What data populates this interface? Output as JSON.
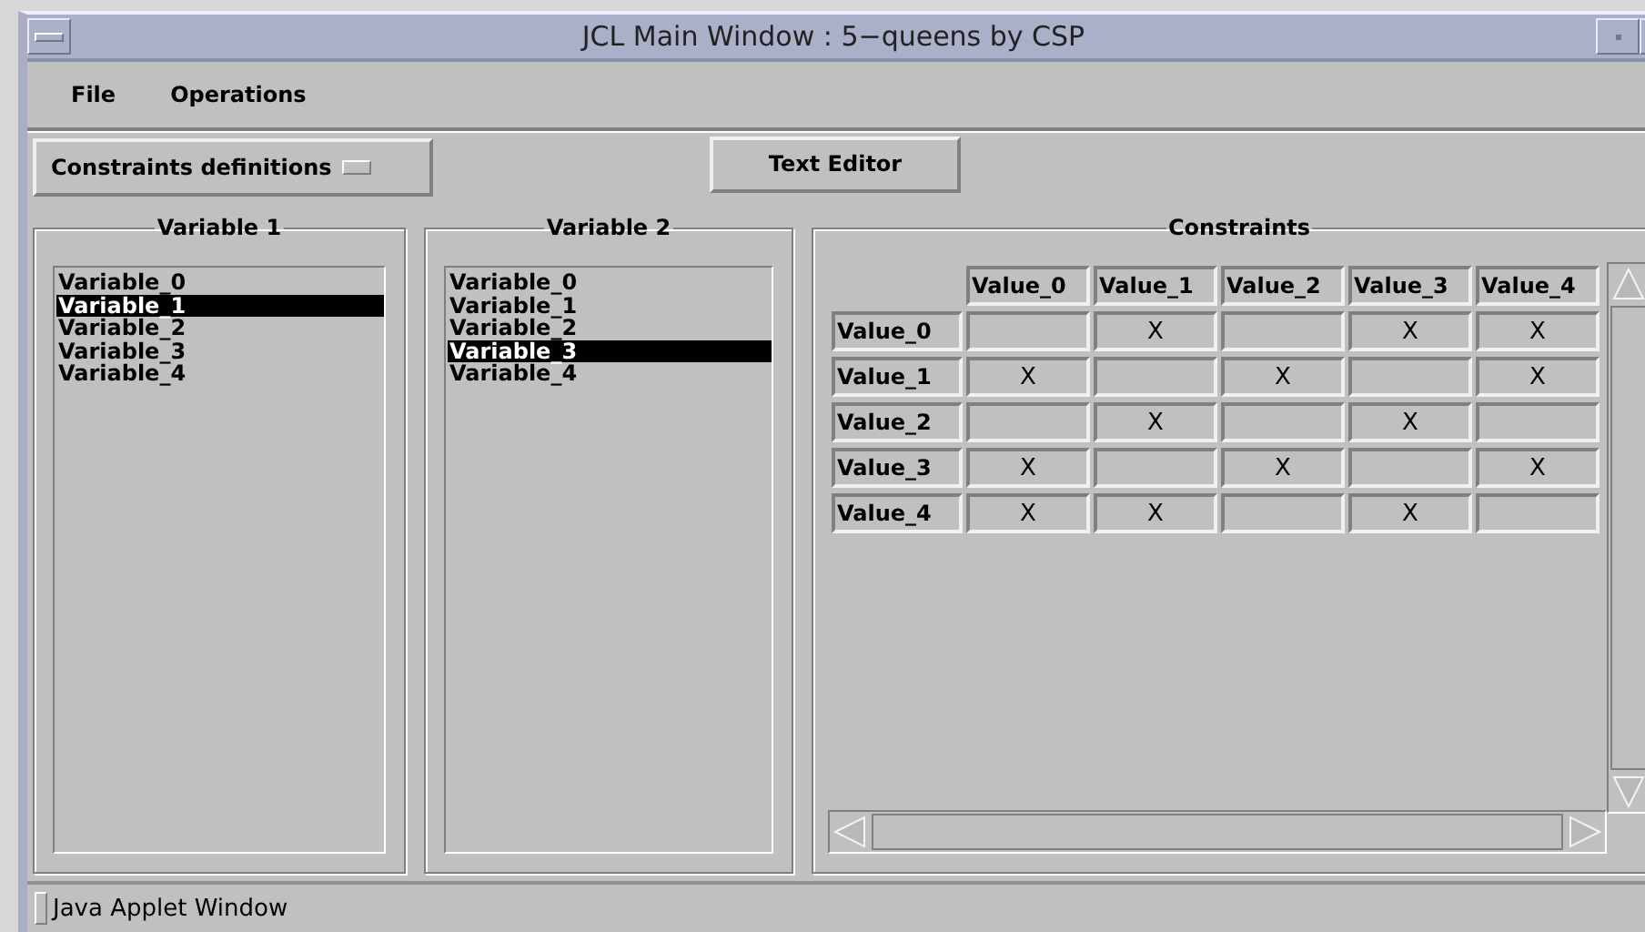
{
  "window": {
    "title": "JCL Main Window : 5−queens by CSP"
  },
  "menu": [
    "File",
    "Operations"
  ],
  "toolbar": {
    "choice": "Constraints definitions",
    "button": "Text Editor"
  },
  "variable_lists": [
    {
      "title": "Variable 1",
      "items": [
        {
          "label": "Variable_0",
          "selected": false
        },
        {
          "label": "Variable_1",
          "selected": true
        },
        {
          "label": "Variable_2",
          "selected": false
        },
        {
          "label": "Variable_3",
          "selected": false
        },
        {
          "label": "Variable_4",
          "selected": false
        }
      ]
    },
    {
      "title": "Variable 2",
      "items": [
        {
          "label": "Variable_0",
          "selected": false
        },
        {
          "label": "Variable_1",
          "selected": false
        },
        {
          "label": "Variable_2",
          "selected": false
        },
        {
          "label": "Variable_3",
          "selected": true
        },
        {
          "label": "Variable_4",
          "selected": false
        }
      ]
    }
  ],
  "constraints": {
    "title": "Constraints",
    "columns": [
      "Value_0",
      "Value_1",
      "Value_2",
      "Value_3",
      "Value_4"
    ],
    "rows": [
      {
        "label": "Value_0",
        "cells": [
          null,
          "X",
          null,
          "X",
          "X"
        ]
      },
      {
        "label": "Value_1",
        "cells": [
          "X",
          null,
          "X",
          null,
          "X"
        ]
      },
      {
        "label": "Value_2",
        "cells": [
          null,
          "X",
          null,
          "X",
          null
        ]
      },
      {
        "label": "Value_3",
        "cells": [
          "X",
          null,
          "X",
          null,
          "X"
        ]
      },
      {
        "label": "Value_4",
        "cells": [
          "X",
          "X",
          null,
          "X",
          null
        ]
      }
    ]
  },
  "status_bar": "Java Applet Window"
}
